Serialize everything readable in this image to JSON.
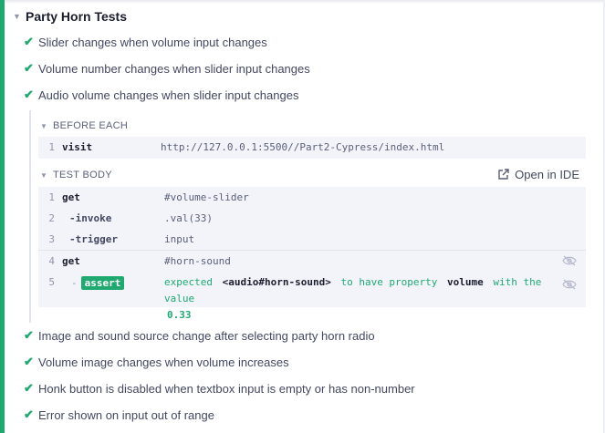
{
  "suite": {
    "title": "Party Horn Tests"
  },
  "tests_before": [
    {
      "title": "Slider changes when volume input changes"
    },
    {
      "title": "Volume number changes when slider input changes"
    },
    {
      "title": "Audio volume changes when slider input changes"
    }
  ],
  "before_each": {
    "label": "BEFORE EACH",
    "commands": [
      {
        "num": "1",
        "name": "visit",
        "message": "http://127.0.0.1:5500//Part2-Cypress/index.html"
      }
    ]
  },
  "test_body": {
    "label": "TEST BODY",
    "open_in_ide": "Open in IDE",
    "commands": [
      {
        "num": "1",
        "name": "get",
        "message": "#volume-slider"
      },
      {
        "num": "2",
        "name": "-invoke",
        "message": ".val(33)"
      },
      {
        "num": "3",
        "name": "-trigger",
        "message": "input"
      },
      {
        "num": "4",
        "name": "get",
        "message": "#horn-sound"
      },
      {
        "num": "5",
        "dash": "-",
        "name": "assert",
        "msg_expected": "expected",
        "msg_element": "<audio#horn-sound>",
        "msg_middle": "to have property",
        "msg_prop": "volume",
        "msg_with": "with the value",
        "msg_value": "0.33"
      }
    ]
  },
  "tests_after": [
    {
      "title": "Image and sound source change after selecting party horn radio"
    },
    {
      "title": "Volume image changes when volume increases"
    },
    {
      "title": "Honk button is disabled when textbox input is empty or has non-number"
    },
    {
      "title": "Error shown on input out of range"
    }
  ],
  "icons": {
    "pass": "check-icon",
    "collapse": "caret-down-icon",
    "hidden": "eye-slash-icon",
    "external": "external-link-icon"
  },
  "colors": {
    "pass_green": "#1fa971",
    "command_bg": "#f3f4fa",
    "text": "#434861"
  }
}
